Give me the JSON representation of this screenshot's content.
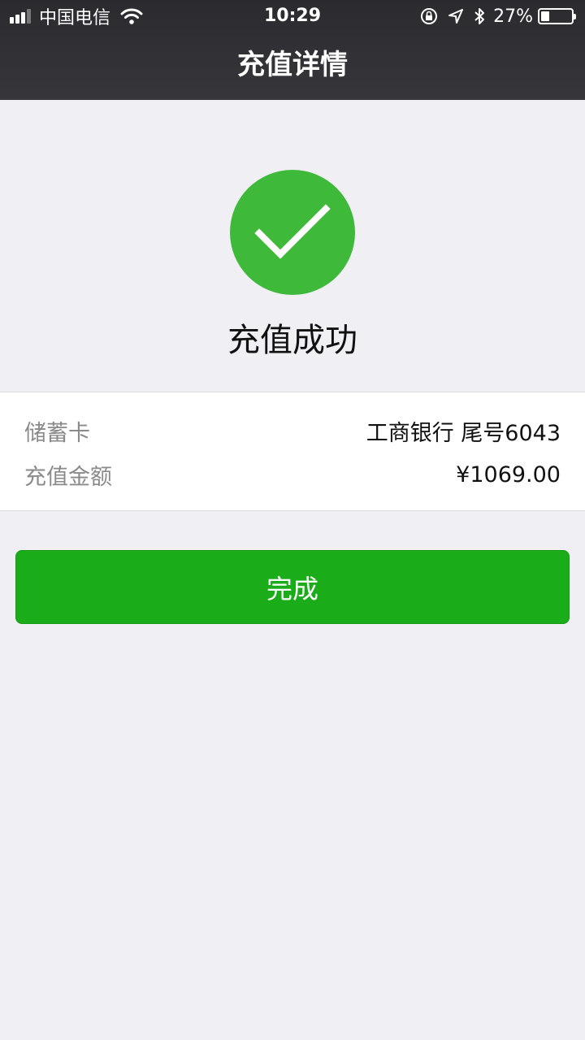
{
  "status_bar": {
    "carrier": "中国电信",
    "time": "10:29",
    "battery_percent_text": "27%",
    "battery_level": 0.27,
    "icons": [
      "signal-icon",
      "wifi-icon",
      "rotation-lock-icon",
      "location-icon",
      "bluetooth-icon",
      "battery-icon"
    ]
  },
  "nav": {
    "title": "充值详情"
  },
  "result": {
    "icon": "check-icon",
    "color": "#3fb93a",
    "text": "充值成功"
  },
  "details": [
    {
      "label": "储蓄卡",
      "value": "工商银行 尾号6043"
    },
    {
      "label": "充值金额",
      "value": "¥1069.00"
    }
  ],
  "done_button": {
    "label": "完成",
    "color": "#1aad19"
  }
}
